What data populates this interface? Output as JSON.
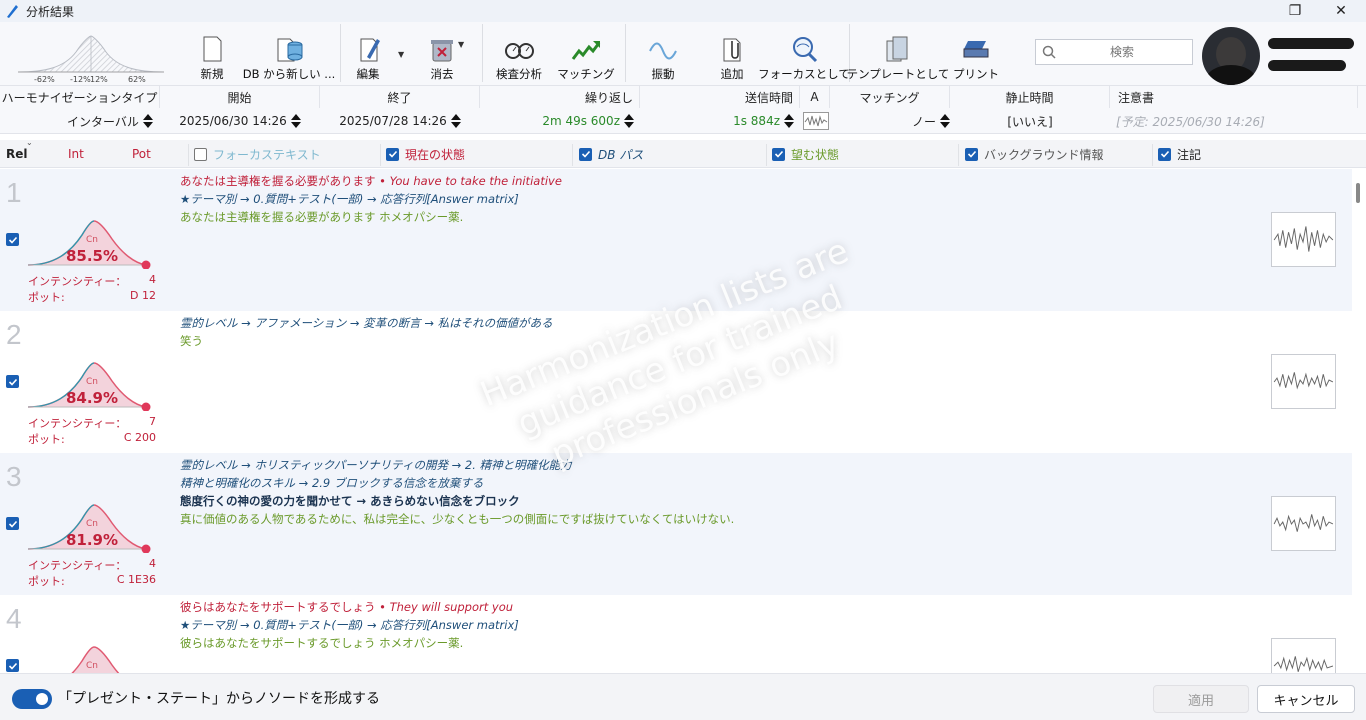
{
  "window": {
    "title": "分析結果",
    "restore_icon": "restore-icon",
    "close_icon": "close-icon"
  },
  "toolbar": {
    "distribution": {
      "tick_labels": [
        "-62%",
        "-12%",
        "12%",
        "62%"
      ]
    },
    "buttons": [
      {
        "label": "新規",
        "icon": "new-document-icon"
      },
      {
        "label": "DB から新しい ...",
        "icon": "database-new-icon"
      },
      {
        "label": "編集",
        "icon": "edit-pencil-icon"
      },
      {
        "label": "消去",
        "icon": "delete-trash-icon"
      },
      {
        "label": "検査分析",
        "icon": "inspection-glasses-icon"
      },
      {
        "label": "マッチング",
        "icon": "matching-arrow-icon"
      },
      {
        "label": "振動",
        "icon": "vibration-wave-icon"
      },
      {
        "label": "追加",
        "icon": "add-paperclip-icon"
      },
      {
        "label": "フォーカスとして",
        "icon": "focus-magnifier-icon"
      },
      {
        "label": "テンプレートとして",
        "icon": "template-pages-icon"
      },
      {
        "label": "プリント",
        "icon": "printer-icon"
      }
    ],
    "search": {
      "placeholder": "検索",
      "icon": "search-icon"
    }
  },
  "header_row1": [
    "ハーモナイゼーションタイプ",
    "開始",
    "終了",
    "繰り返し",
    "送信時間",
    "A",
    "マッチング",
    "静止時間",
    "注意書"
  ],
  "header_row2": {
    "type": "インターバル",
    "start": "2025/06/30 14:26",
    "end": "2025/07/28 14:26",
    "repeat": "2m 49s 600z",
    "send_time": "1s 884z",
    "matching": "ノー",
    "rest": "[いいえ]",
    "note": "[予定: 2025/06/30 14:26]"
  },
  "columns": {
    "rel": "Rel",
    "int": "Int",
    "pot": "Pot",
    "focus_text": "フォーカステキスト",
    "current_state": "現在の状態",
    "db_path": "DB パス",
    "desired_state": "望む状態",
    "background_info": "バックグラウンド情報",
    "notes": "注記"
  },
  "labels": {
    "intensity": "インテンシティー：",
    "potency": "ポット:",
    "cn": "Cn"
  },
  "rows": [
    {
      "num": "1",
      "pct": "85.5%",
      "intensity": "4",
      "potency": "D 12",
      "line1_a": "あなたは主導権を握る必要があります",
      "line1_b": " • You have to take the initiative",
      "line2": "★テーマ別 → 0.質問+テスト(一部) → 応答行列[Answer matrix]",
      "line3": "あなたは主導権を握る必要があります ホメオパシー薬."
    },
    {
      "num": "2",
      "pct": "84.9%",
      "intensity": "7",
      "potency": "C 200",
      "line1_a": "霊的レベル → アファメーション → 変革の断言 → 私はそれの価値がある",
      "line2": "笑う"
    },
    {
      "num": "3",
      "pct": "81.9%",
      "intensity": "4",
      "potency": "C 1E36",
      "line1_a": "霊的レベル → ホリスティックパーソナリティの開発 → 2. 精神と明確化能力",
      "line2": "精神と明確化のスキル → 2.9 ブロックする信念を放棄する",
      "line3": "態度行くの神の愛の力を聞かせて → あきらめない信念をブロック",
      "line4": "真に価値のある人物であるために、私は完全に、少なくとも一つの側面にですば抜けていなくてはいけない."
    },
    {
      "num": "4",
      "line1_a": "彼らはあなたをサポートするでしょう",
      "line1_b": " • They will support you",
      "line2": "★テーマ別 → 0.質問+テスト(一部) → 応答行列[Answer matrix]",
      "line3": "彼らはあなたをサポートするでしょう ホメオパシー薬."
    }
  ],
  "watermark": [
    "Harmonization lists are",
    "guidance for trained",
    "professionals only"
  ],
  "footer": {
    "toggle_label": "「プレゼント・ステート」からノソードを形成する",
    "apply": "適用",
    "cancel": "キャンセル"
  }
}
